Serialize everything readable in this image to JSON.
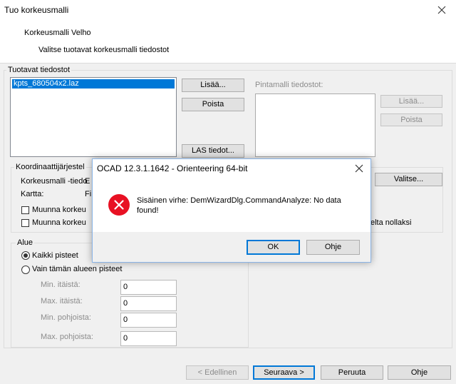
{
  "window": {
    "title": "Tuo korkeusmalli"
  },
  "header": {
    "title": "Korkeusmalli Velho",
    "subtitle": "Valitse tuotavat korkeusmalli tiedostot"
  },
  "files_group": {
    "label": "Tuotavat tiedostot",
    "items": [
      "kpts_680504x2.laz"
    ],
    "add_label": "Lisää...",
    "remove_label": "Poista",
    "las_label": "LAS tiedot..."
  },
  "surface_group": {
    "label": "Pintamalli tiedostot:",
    "add_label": "Lisää...",
    "remove_label": "Poista"
  },
  "coord_group": {
    "label": "Koordinaattijärjestel",
    "file_label": "Korkeusmalli -tiedo",
    "file_value": "E",
    "map_label": "Kartta:",
    "map_value": "Fi",
    "select_label": "Valitse...",
    "cb1_label": "Muunna korkeu",
    "cb2_label": "Muunna korkeu",
    "cb2_suffix": "elta nollaksi"
  },
  "area_group": {
    "label": "Alue",
    "radio_all": "Kaikki pisteet",
    "radio_area": "Vain tämän alueen pisteet",
    "min_east_label": "Min. itäistä:",
    "max_east_label": "Max. itäistä:",
    "min_north_label": "Min. pohjoista:",
    "max_north_label": "Max. pohjoista:",
    "min_east": "0",
    "max_east": "0",
    "min_north": "0",
    "max_north": "0"
  },
  "footer": {
    "back_label": "< Edellinen",
    "next_label": "Seuraava >",
    "cancel_label": "Peruuta",
    "help_label": "Ohje"
  },
  "error_dialog": {
    "title": "OCAD 12.3.1.1642 - Orienteering 64-bit",
    "message_line1": "Sisäinen virhe: DemWizardDlg.CommandAnalyze: No data",
    "message_line2": "found!",
    "ok_label": "OK",
    "help_label": "Ohje",
    "icon": "error-icon",
    "icon_color": "#e81123"
  }
}
